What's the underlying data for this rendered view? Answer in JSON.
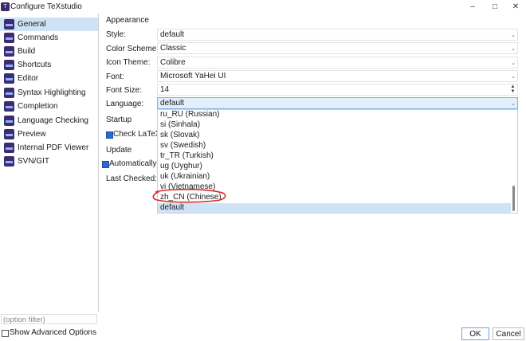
{
  "window": {
    "title": "Configure TeXstudio",
    "minimize": "–",
    "maximize": "□",
    "close": "✕",
    "icon": "texstudio-icon"
  },
  "sidebar": {
    "items": [
      {
        "label": "General",
        "selected": true
      },
      {
        "label": "Commands"
      },
      {
        "label": "Build"
      },
      {
        "label": "Shortcuts"
      },
      {
        "label": "Editor"
      },
      {
        "label": "Syntax Highlighting"
      },
      {
        "label": "Completion"
      },
      {
        "label": "Language Checking"
      },
      {
        "label": "Preview"
      },
      {
        "label": "Internal PDF Viewer"
      },
      {
        "label": "SVN/GIT"
      }
    ],
    "filter_placeholder": "(option filter)",
    "show_advanced": "Show Advanced Options"
  },
  "appearance": {
    "heading": "Appearance",
    "style_label": "Style:",
    "style_value": "default",
    "scheme_label": "Color Scheme:",
    "scheme_value": "Classic",
    "icon_label": "Icon Theme:",
    "icon_value": "Colibre",
    "font_label": "Font:",
    "font_value": "Microsoft YaHei UI",
    "size_label": "Font Size:",
    "size_value": "14",
    "language_label": "Language:",
    "language_value": "default"
  },
  "startup": {
    "heading": "Startup",
    "check_latex": "Check LaTeX"
  },
  "update": {
    "heading": "Update",
    "automatically": "Automatically",
    "last_checked": "Last Checked:"
  },
  "language_options": [
    "ru_RU  (Russian)",
    "si  (Sinhala)",
    "sk  (Slovak)",
    "sv  (Swedish)",
    "tr_TR  (Turkish)",
    "ug  (Uyghur)",
    "uk  (Ukrainian)",
    "vi  (Vietnamese)",
    "zh_CN  (Chinese)",
    "default"
  ],
  "buttons": {
    "ok": "OK",
    "cancel": "Cancel"
  },
  "colors": {
    "selection": "#cfe3f7",
    "annotation": "#d62828",
    "accent": "#2a6ad0"
  }
}
